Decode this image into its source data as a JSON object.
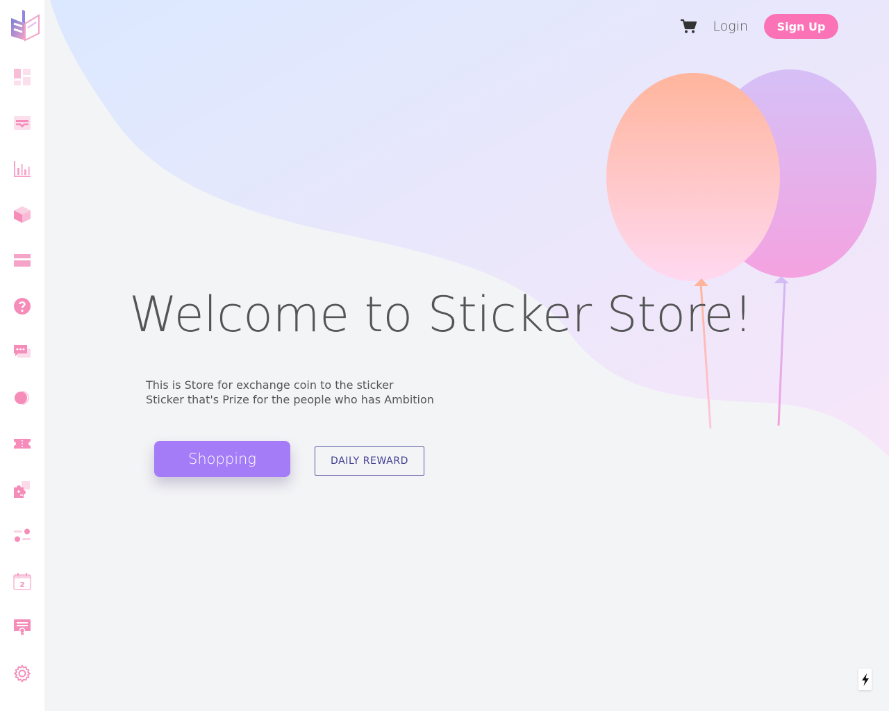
{
  "header": {
    "cart_icon": "shopping-cart-icon",
    "login_label": "Login",
    "signup_label": "Sign Up"
  },
  "sidebar": {
    "logo_icon": "brand-logo",
    "items": [
      {
        "icon": "dashboard-icon"
      },
      {
        "icon": "inbox-icon"
      },
      {
        "icon": "bar-chart-icon"
      },
      {
        "icon": "cube-icon"
      },
      {
        "icon": "credit-card-icon"
      },
      {
        "icon": "help-icon"
      },
      {
        "icon": "chat-icon"
      },
      {
        "icon": "toggle-icon"
      },
      {
        "icon": "ticket-icon"
      },
      {
        "icon": "puzzle-icon"
      },
      {
        "icon": "settings-sliders-icon"
      },
      {
        "icon": "calendar-icon"
      },
      {
        "icon": "certificate-icon"
      },
      {
        "icon": "gear-icon"
      }
    ],
    "calendar_day": "2"
  },
  "hero": {
    "title": "Welcome to Sticker Store!",
    "desc_line1": "This is Store for exchange coin to the sticker",
    "desc_line2": "Sticker that's Prize for the people who has Ambition",
    "shop_label": "Shopping",
    "daily_label": "DAILY REWARD"
  },
  "colors": {
    "accent_pink": "#fb72b7",
    "accent_purple": "#a57cf7",
    "icon_pink": "#f5a3c8",
    "text": "#555555",
    "outline_blue": "#5a58a8"
  },
  "floating_action_icon": "lightning-icon"
}
